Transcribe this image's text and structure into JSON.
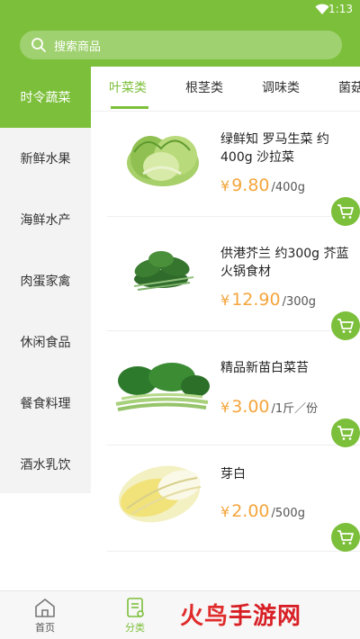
{
  "status_bar": {
    "time": "1:13",
    "icons": [
      "wifi-icon",
      "battery-icon"
    ]
  },
  "search": {
    "placeholder": "搜索商品",
    "icon": "search-icon"
  },
  "sidebar": {
    "items": [
      {
        "label": "时令蔬菜",
        "active": true
      },
      {
        "label": "新鲜水果",
        "active": false
      },
      {
        "label": "海鲜水产",
        "active": false
      },
      {
        "label": "肉蛋家禽",
        "active": false
      },
      {
        "label": "休闲食品",
        "active": false
      },
      {
        "label": "餐食料理",
        "active": false
      },
      {
        "label": "酒水乳饮",
        "active": false
      }
    ]
  },
  "tabs": [
    {
      "label": "叶菜类",
      "active": true
    },
    {
      "label": "根茎类",
      "active": false
    },
    {
      "label": "调味类",
      "active": false
    },
    {
      "label": "菌菇",
      "active": false
    }
  ],
  "products": [
    {
      "name": "绿鲜知 罗马生菜 约400g 沙拉菜",
      "currency": "¥",
      "price": "9.80",
      "unit": "/400g"
    },
    {
      "name": "供港芥兰 约300g 芥蓝 火锅食材",
      "currency": "¥",
      "price": "12.90",
      "unit": "/300g"
    },
    {
      "name": "精品新苗白菜苔",
      "currency": "¥",
      "price": "3.00",
      "unit": "/1斤／份"
    },
    {
      "name": "芽白",
      "currency": "¥",
      "price": "2.00",
      "unit": "/500g"
    }
  ],
  "bottom_nav": [
    {
      "label": "首页",
      "icon": "home-icon",
      "active": false
    },
    {
      "label": "分类",
      "icon": "category-icon",
      "active": true
    }
  ],
  "watermark": {
    "part1": "火鸟",
    "part2": "手游网"
  },
  "colors": {
    "accent": "#7cbf3a",
    "price": "#f4a53c",
    "sidebar_bg": "#f3f3f3"
  }
}
